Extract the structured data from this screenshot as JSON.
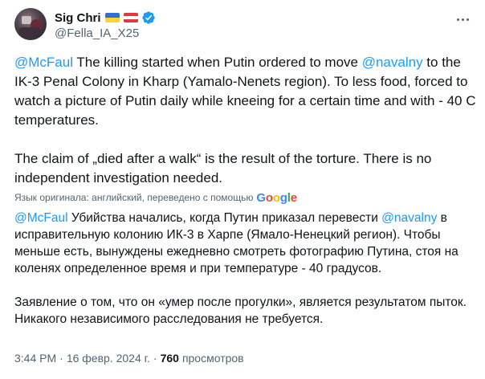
{
  "author": {
    "display_name": "Sig Chri",
    "handle": "@Fella_IA_X25",
    "flags": [
      "ukraine-flag",
      "austria-flag"
    ],
    "verified": true
  },
  "tweet": {
    "para1": {
      "mention1": "@McFaul",
      "text1": " The killing started when Putin ordered to move ",
      "mention2": "@navalny",
      "text2": " to the IK-3 Penal Colony in Kharp (Yamalo-Nenets region). To less food, forced to watch a picture of Putin daily while kneeing for a certain time and with - 40 C temperatures."
    },
    "para2": "The claim of „died after a walk“ is the result of the torture. There is no independent investigation needed."
  },
  "translation": {
    "note": "Язык оригинала: английский, переведено с помощью",
    "provider": [
      "G",
      "o",
      "o",
      "g",
      "l",
      "e"
    ],
    "para1": {
      "mention1": "@McFaul",
      "text1": " Убийства начались, когда Путин приказал перевести ",
      "mention2": "@navalny",
      "text2": " в исправительную колонию ИК-3 в Харпе (Ямало-Ненецкий регион). Чтобы меньше есть, вынуждены ежедневно смотреть фотографию Путина, стоя на коленях определенное время и при температуре - 40 градусов."
    },
    "para2": "Заявление о том, что он «умер после прогулки», является результатом пыток. Никакого независимого расследования не требуется."
  },
  "meta": {
    "time": "3:44 PM",
    "separator": "·",
    "date": "16 февр. 2024 г.",
    "views_count": "760",
    "views_label": "просмотров"
  },
  "colors": {
    "accent": "#1d9bf0",
    "text": "#0f1419",
    "secondary": "#536471"
  }
}
